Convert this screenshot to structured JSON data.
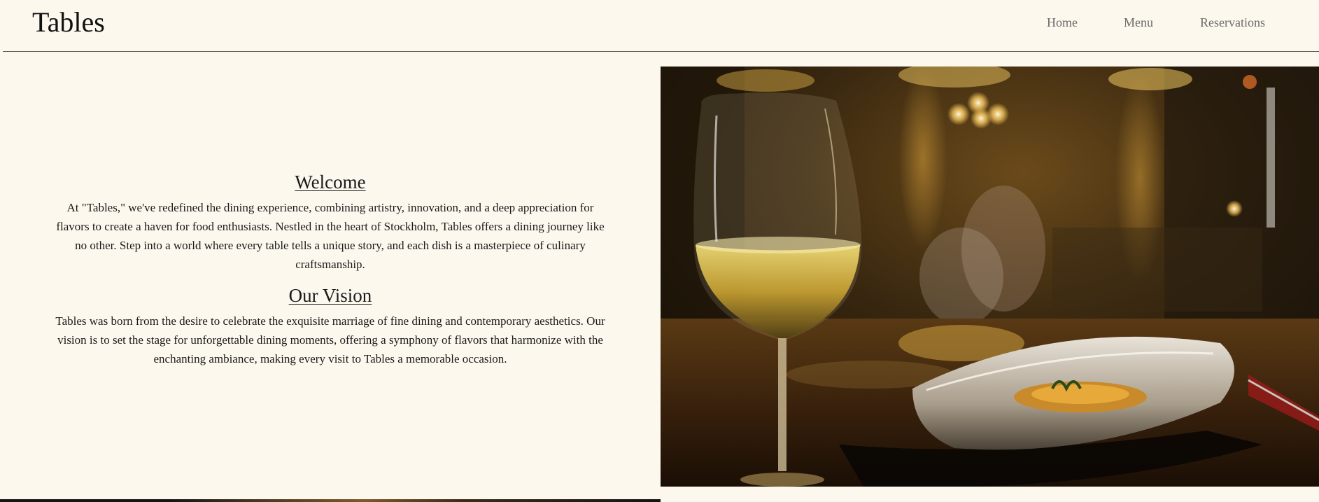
{
  "header": {
    "logo": "Tables",
    "nav": [
      {
        "label": "Home"
      },
      {
        "label": "Menu"
      },
      {
        "label": "Reservations"
      }
    ]
  },
  "welcome": {
    "heading": "Welcome",
    "body": "At \"Tables,\" we've redefined the dining experience, combining artistry, innovation, and a deep appreciation for flavors to create a haven for food enthusiasts. Nestled in the heart of Stockholm, Tables offers a dining journey like no other. Step into a world where every table tells a unique story, and each dish is a masterpiece of culinary craftsmanship."
  },
  "vision": {
    "heading": "Our Vision",
    "body": "Tables was born from the desire to celebrate the exquisite marriage of fine dining and contemporary aesthetics. Our vision is to set the stage for unforgettable dining moments, offering a symphony of flavors that harmonize with the enchanting ambiance, making every visit to Tables a memorable occasion."
  },
  "colors": {
    "background": "#fdf8ee",
    "text": "#1a1a1a",
    "nav_text": "#6a6a6a",
    "rule": "#5a5a5a"
  }
}
